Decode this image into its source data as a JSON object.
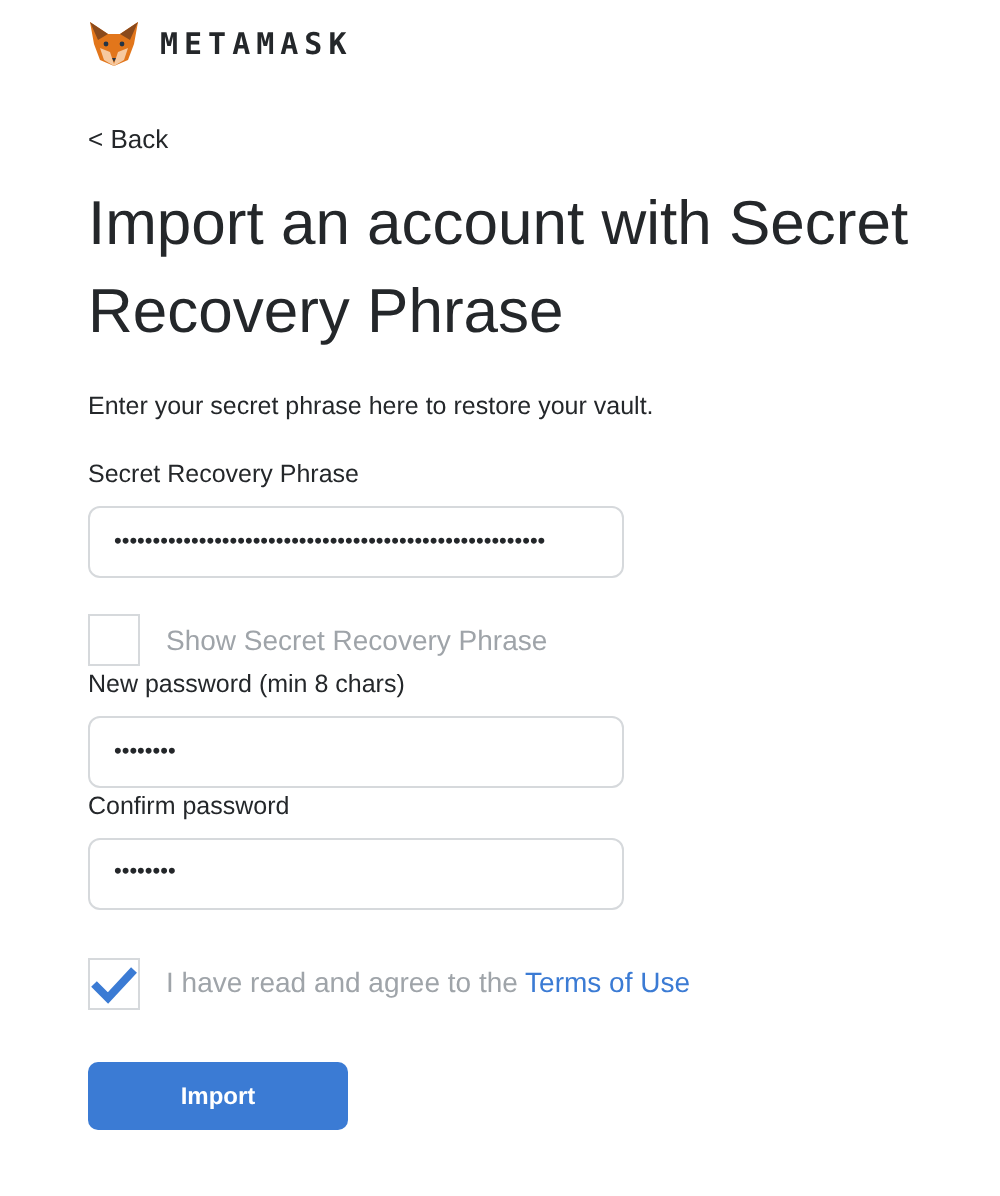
{
  "brand": {
    "name": "METAMASK"
  },
  "back_link": "< Back",
  "title": "Import an account with Secret Recovery Phrase",
  "description": "Enter your secret phrase here to restore your vault.",
  "fields": [
    {
      "label": "Secret Recovery Phrase",
      "value": "••••••••••••••••••••••••••••••••••••••••••••••••••••••••"
    },
    {
      "kind": "checkbox",
      "label": "Show Secret Recovery Phrase",
      "checked": false
    },
    {
      "label": "New password (min 8 chars)",
      "value": "••••••••"
    },
    {
      "label": "Confirm password",
      "value": "••••••••"
    }
  ],
  "agreement": {
    "checked": true,
    "text": "I have read and agree to the ",
    "link": "Terms of Use"
  },
  "import_button": "Import"
}
